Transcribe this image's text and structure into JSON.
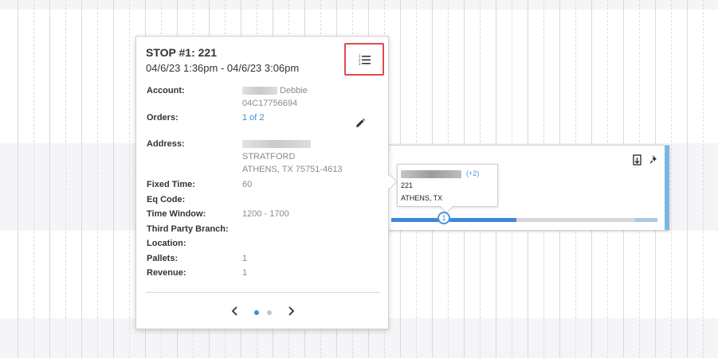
{
  "popover": {
    "title": "STOP #1: 221",
    "time_range": "04/6/23 1:36pm - 04/6/23 3:06pm",
    "fields": [
      {
        "label": "Account:",
        "lines": [
          "Debbie",
          "04C17756694"
        ]
      },
      {
        "label": "Orders:",
        "link": "1 of 2"
      },
      {
        "label": "Address:",
        "lines": [
          "STRATFORD",
          "ATHENS, TX 75751-4613"
        ]
      },
      {
        "label": "Fixed Time:",
        "value": "60"
      },
      {
        "label": "Eq Code:",
        "value": ""
      },
      {
        "label": "Time Window:",
        "value": "1200 - 1700"
      },
      {
        "label": "Third Party Branch:",
        "value": ""
      },
      {
        "label": "Location:",
        "value": ""
      },
      {
        "label": "Pallets:",
        "value": "1"
      },
      {
        "label": "Revenue:",
        "value": "1"
      }
    ],
    "pager": {
      "current_page": 1,
      "total_pages": 2
    }
  },
  "route_card": {
    "tooltip": {
      "more": "(+2)",
      "stop_name": "221",
      "city": "ATHENS, TX"
    },
    "stop_marker": "1"
  },
  "colors": {
    "accent_blue": "#3a8fd8",
    "highlight_red": "#e04a4a",
    "route_done": "#3f86d8",
    "route_remaining": "#d6d6da"
  },
  "icons": [
    "numbered-list-icon",
    "pencil-icon",
    "chevron-left-icon",
    "chevron-right-icon",
    "export-icon",
    "pin-icon"
  ]
}
